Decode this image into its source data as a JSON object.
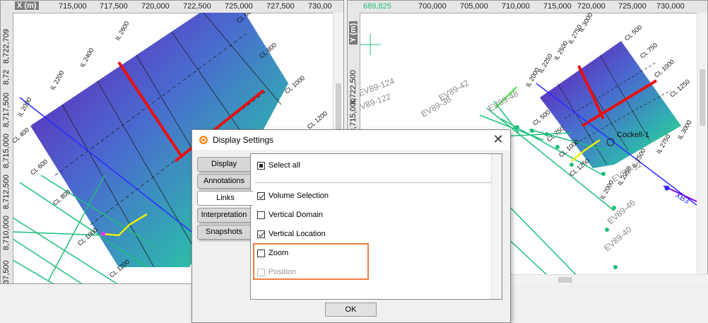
{
  "left_view": {
    "x_axis_name": "X (m)",
    "x_ticks": [
      "715,000",
      "717,500",
      "720,000",
      "722,500",
      "725,000",
      "727,500",
      "730,00"
    ],
    "y_ticks": [
      "8,722,709",
      "8,72",
      "8,717,500",
      "8,715,000",
      "8,712,500",
      "8,710,000",
      "37,500"
    ],
    "line_labels": [
      "IL 2600",
      "IL 2400",
      "IL 2200",
      "IL 2000",
      "CL 400",
      "CL 600",
      "CL 800",
      "CL 1000",
      "CL 1200",
      "CL 600",
      "CL 800",
      "CL 1000",
      "CL 1200"
    ]
  },
  "right_view": {
    "y_axis_name": "Y (m)",
    "x_ticks": [
      "689,825",
      "700,000",
      "705,000",
      "710,000",
      "715,000",
      "720,000",
      "725,000",
      "730,000"
    ],
    "y_ticks": [
      "8,722,500",
      "8,715,000",
      "8,715,000"
    ],
    "line_labels": [
      "IL 3000",
      "IL 2750",
      "IL 2500",
      "IL 2250",
      "IL 2000",
      "CL 500",
      "CL 750",
      "CL 1000",
      "CL 1250",
      "CL 500",
      "CL 750",
      "CL 1000",
      "CL 1250",
      "IL 2500",
      "IL 2750",
      "IL 3000",
      "IL 2250",
      "IL 2000"
    ],
    "survey_labels": [
      "EV89-124",
      "EV89-122",
      "EV89-42",
      "EV89-38",
      "EV89-48",
      "EV89-52",
      "EV89-46",
      "EV89-40"
    ],
    "well_label": "Cockell-1",
    "well_tag": "XB3"
  },
  "dialog": {
    "title": "Display Settings",
    "close_glyph": "✕",
    "tabs": [
      "Display",
      "Annotations",
      "Links",
      "Interpretation",
      "Snapshots"
    ],
    "active_tab": "Links",
    "select_all": "Select all",
    "options": [
      {
        "label": "Volume Selection",
        "checked": true,
        "enabled": true
      },
      {
        "label": "Vertical Domain",
        "checked": false,
        "enabled": true
      },
      {
        "label": "Vertical Location",
        "checked": true,
        "enabled": true
      },
      {
        "label": "Zoom",
        "checked": false,
        "enabled": true
      },
      {
        "label": "Position",
        "checked": false,
        "enabled": false
      }
    ],
    "ok_label": "OK"
  },
  "colors": {
    "accent_highlight": "#f08040",
    "line_green": "#1ec07a",
    "well_blue": "#2a2aff",
    "inline_red": "#e81010"
  }
}
